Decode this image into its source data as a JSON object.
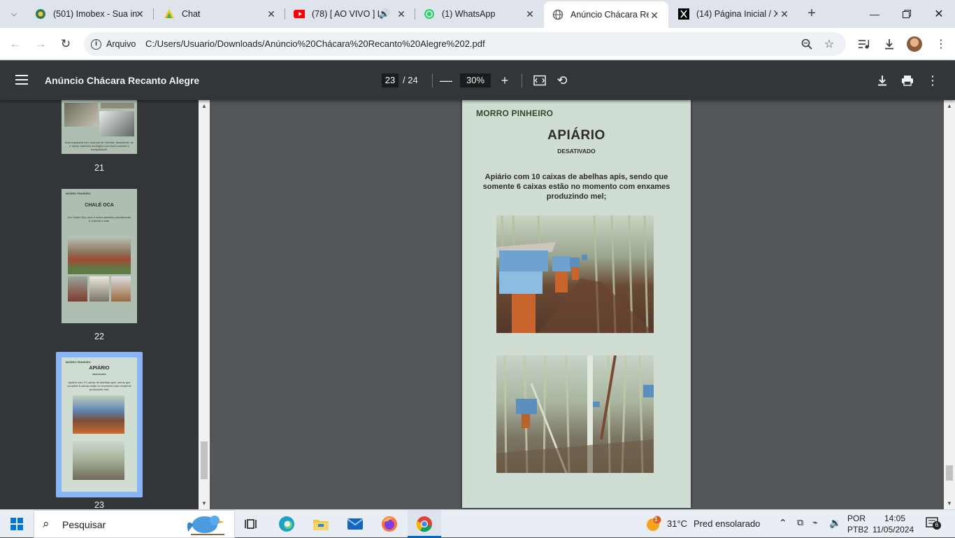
{
  "browser": {
    "tabs": [
      {
        "label": "(501) Imobex - Sua in",
        "icon": "imobex-icon"
      },
      {
        "label": "Chat",
        "icon": "chat-icon"
      },
      {
        "label": "(78) [ AO VIVO ] L",
        "icon": "youtube-icon"
      },
      {
        "label": "(1) WhatsApp",
        "icon": "whatsapp-icon"
      },
      {
        "label": "Anúncio Chácara Rec",
        "icon": "globe-icon"
      },
      {
        "label": "(14) Página Inicial / X",
        "icon": "x-icon"
      }
    ],
    "active_tab_index": 4,
    "address": {
      "chip_label": "Arquivo",
      "url": "C:/Users/Usuario/Downloads/Anúncio%20Chácara%20Recanto%20Alegre%202.pdf"
    }
  },
  "pdf": {
    "title": "Anúncio Chácara Recanto Alegre",
    "current_page": "23",
    "total_pages": "/ 24",
    "zoom": "30%"
  },
  "sidebar": {
    "thumbnails": [
      {
        "number": "21",
        "caption": "Área equipada com uma pia de vivenda, lavanderia, wc e cama; banheiro ecológico com todo conforto e tranquilidade."
      },
      {
        "number": "22",
        "header": "MORRO PINHEIRO",
        "title": "CHALÉ OCA",
        "text": "Um Chalé Oca, com 4 suítes também parcialmente e cozinha e sala."
      },
      {
        "number": "23",
        "header": "MORRO PINHEIRO",
        "title": "APIÁRIO",
        "sub": "DESATIVADO",
        "text": "Apiário com 10 caixas de abelhas apis, sendo que somente 6 caixas estão no momento com enxames produzindo mel;"
      }
    ]
  },
  "page": {
    "header": "MORRO PINHEIRO",
    "title": "APIÁRIO",
    "subtitle": "DESATIVADO",
    "body": "Apiário com 10 caixas de abelhas apis, sendo que somente 6 caixas estão no momento com enxames produzindo mel;"
  },
  "taskbar": {
    "search_label": "Pesquisar",
    "weather_temp": "31°C",
    "weather_desc": "Pred ensolarado",
    "weather_badge": "1",
    "lang_top": "POR",
    "lang_bottom": "PTB2",
    "time": "14:05",
    "date": "11/05/2024",
    "notification_count": "6"
  },
  "colors": {
    "pdf_toolbar": "#323639",
    "pdf_background": "#525659",
    "page_background": "#d0ddd3",
    "header_green": "#2f4a2c",
    "selection": "#8ab4f8"
  }
}
